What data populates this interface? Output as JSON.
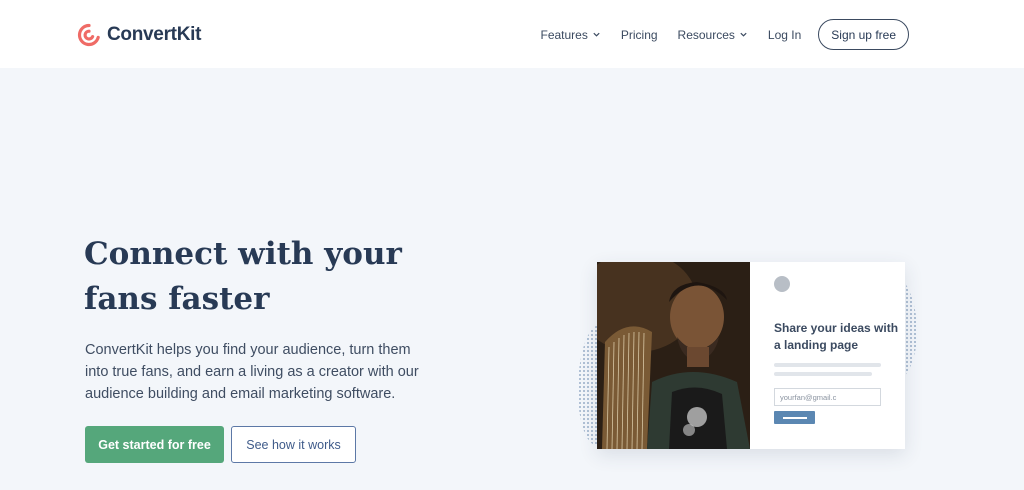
{
  "brand": {
    "name": "ConvertKit",
    "accent": "#ef6b66"
  },
  "nav": {
    "items": [
      {
        "label": "Features",
        "has_dropdown": true
      },
      {
        "label": "Pricing",
        "has_dropdown": false
      },
      {
        "label": "Resources",
        "has_dropdown": true
      },
      {
        "label": "Log In",
        "has_dropdown": false
      }
    ],
    "signup_label": "Sign up free"
  },
  "hero": {
    "headline_line1": "Connect with your",
    "headline_line2": "fans faster",
    "subtext": "ConvertKit helps you find your audience, turn them into true fans, and earn a living as a creator with our audience building and email marketing software.",
    "primary_cta": "Get started for free",
    "secondary_cta": "See how it works",
    "primary_color": "#55a77b",
    "secondary_color": "#5c78a6"
  },
  "illustration": {
    "card_title": "Share your ideas with a landing page",
    "email_value": "yourfan@gmail.c",
    "button_color": "#5b87b2",
    "photo_subject": "musician-with-harp"
  }
}
